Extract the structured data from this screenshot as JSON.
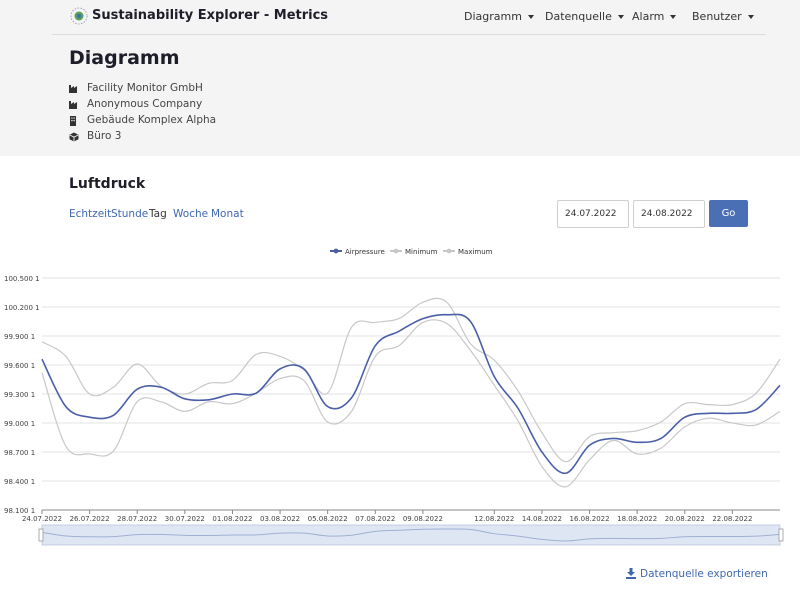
{
  "app": {
    "title": "Sustainability Explorer - Metrics",
    "nav": [
      {
        "label": "Diagramm"
      },
      {
        "label": "Datenquelle"
      },
      {
        "label": "Alarm"
      },
      {
        "label": "Benutzer"
      }
    ]
  },
  "page": {
    "title": "Diagramm",
    "breadcrumb": [
      {
        "label": "Facility Monitor GmbH",
        "icon": "factory-icon"
      },
      {
        "label": "Anonymous Company",
        "icon": "factory-icon"
      },
      {
        "label": "Gebäude Komplex Alpha",
        "icon": "building-icon"
      },
      {
        "label": "Büro 3",
        "icon": "cube-icon"
      }
    ]
  },
  "chart_section": {
    "title": "Luftdruck",
    "ranges": [
      "Echtzeit",
      "Stunde",
      "Tag",
      "Woche",
      "Monat"
    ],
    "active_range": "Tag",
    "date_from": "24.07.2022",
    "date_to": "24.08.2022",
    "go_label": "Go",
    "export_label": "Datenquelle exportieren"
  },
  "colors": {
    "accent": "#4a6fb5",
    "series_main": "#4a5fa8",
    "series_minmax": "#c8c8c8",
    "link": "#3f67b1"
  },
  "chart_data": {
    "type": "line",
    "x": [
      "24.07.2022",
      "25.07.2022",
      "26.07.2022",
      "27.07.2022",
      "28.07.2022",
      "29.07.2022",
      "30.07.2022",
      "31.07.2022",
      "01.08.2022",
      "02.08.2022",
      "03.08.2022",
      "04.08.2022",
      "05.08.2022",
      "06.08.2022",
      "07.08.2022",
      "08.08.2022",
      "09.08.2022",
      "10.08.2022",
      "11.08.2022",
      "12.08.2022",
      "13.08.2022",
      "14.08.2022",
      "15.08.2022",
      "16.08.2022",
      "17.08.2022",
      "18.08.2022",
      "19.08.2022",
      "20.08.2022",
      "21.08.2022",
      "22.08.2022",
      "23.08.2022",
      "24.08.2022"
    ],
    "xticks": [
      "24.07.2022",
      "26.07.2022",
      "28.07.2022",
      "30.07.2022",
      "01.08.2022",
      "03.08.2022",
      "05.08.2022",
      "07.08.2022",
      "09.08.2022",
      "12.08.2022",
      "14.08.2022",
      "16.08.2022",
      "18.08.2022",
      "20.08.2022",
      "22.08.2022"
    ],
    "yticks": [
      "98.100 1",
      "98.400 1",
      "98.700 1",
      "99.000 1",
      "99.300 1",
      "99.600 1",
      "99.900 1",
      "100.200 1",
      "100.500 1"
    ],
    "ylim": [
      98.1,
      100.5
    ],
    "series": [
      {
        "name": "Airpressure",
        "values": [
          99.66,
          99.17,
          99.06,
          99.08,
          99.35,
          99.37,
          99.25,
          99.24,
          99.3,
          99.31,
          99.56,
          99.56,
          99.17,
          99.26,
          99.8,
          99.95,
          100.08,
          100.12,
          100.05,
          99.48,
          99.15,
          98.7,
          98.48,
          98.77,
          98.84,
          98.8,
          98.84,
          99.06,
          99.1,
          99.1,
          99.14,
          99.39
        ]
      },
      {
        "name": "Minimum",
        "values": [
          99.52,
          98.76,
          98.68,
          98.71,
          99.22,
          99.22,
          99.12,
          99.22,
          99.2,
          99.31,
          99.46,
          99.44,
          99.01,
          99.12,
          99.69,
          99.8,
          100.04,
          100.03,
          99.75,
          99.39,
          99.02,
          98.55,
          98.34,
          98.62,
          98.82,
          98.68,
          98.74,
          98.96,
          99.05,
          99.0,
          98.98,
          99.12
        ]
      },
      {
        "name": "Maximum",
        "values": [
          99.84,
          99.69,
          99.3,
          99.37,
          99.61,
          99.38,
          99.3,
          99.41,
          99.44,
          99.71,
          99.69,
          99.55,
          99.31,
          99.99,
          100.04,
          100.08,
          100.25,
          100.25,
          99.82,
          99.65,
          99.33,
          98.9,
          98.6,
          98.86,
          98.9,
          98.92,
          99.01,
          99.2,
          99.19,
          99.19,
          99.31,
          99.66
        ]
      }
    ],
    "legend_position": "top-center",
    "grid": true,
    "navigator": true
  }
}
